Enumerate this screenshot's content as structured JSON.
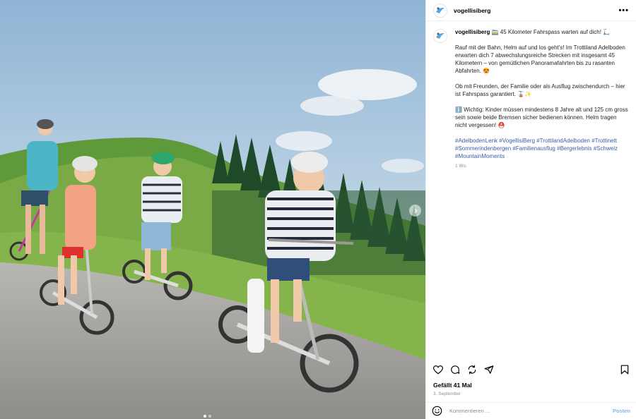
{
  "post": {
    "username": "vogellisiberg",
    "more_label": "•••",
    "caption": {
      "username": "vogellisiberg",
      "headline": " 🚞 45 Kilometer Fahrspass warten auf dich! 🛴",
      "p1": "Rauf mit der Bahn, Helm auf und los geht's! Im Trottiland Adelboden erwarten dich 7 abwechslungsreiche Strecken mit insgesamt 45 Kilometern – von gemütlichen Panoramafahrten bis zu rasanten Abfahrten. 😍",
      "p2": "Ob mit Freunden, der Familie oder als Ausflug zwischendurch – hier ist Fahrspass garantiert. 🚡✨",
      "p3": "ℹ️ Wichtig: Kinder müssen mindestens 8 Jahre alt und 125 cm gross sein sowie beide Bremsen sicher bedienen können. Helm tragen nicht vergessen! ⛑️",
      "hashtags": [
        "#AdelbodenLenk",
        "#VogellisiBerg",
        "#TrottilandAdelboden",
        "#Trottinett",
        "#Sommerindenbergen",
        "#Familienausflug",
        "#Bergerlebnis",
        "#Schweiz",
        "#MountainMoments"
      ],
      "time": "1 Wo."
    },
    "likes": "Gefällt 41 Mal",
    "date": "3. September",
    "comment_placeholder": "Kommentieren ...",
    "post_button": "Posten",
    "icons": [
      "logo-icon",
      "heart-icon",
      "comment-icon",
      "repost-icon",
      "share-icon",
      "bookmark-icon",
      "emoji-icon",
      "chevron-right-icon"
    ],
    "carousel": {
      "count": 2,
      "active": 0
    },
    "colors": {
      "hashtag": "#3b5eab",
      "post_button": "#7fb6f2",
      "muted": "#8e8e8e"
    }
  }
}
